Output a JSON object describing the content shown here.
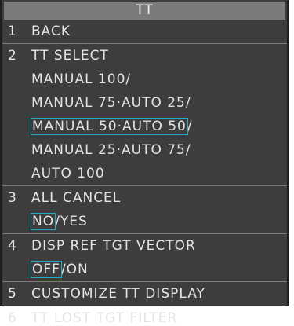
{
  "menu": {
    "title": "TT",
    "items": [
      {
        "num": "1",
        "label": "BACK"
      },
      {
        "num": "2",
        "label": "TT SELECT",
        "options": [
          "MANUAL 100/",
          "MANUAL 75·AUTO 25/",
          "MANUAL 50·AUTO 50",
          "MANUAL 25·AUTO 75/",
          "AUTO 100"
        ],
        "selected_suffix": "/"
      },
      {
        "num": "3",
        "label": "ALL CANCEL",
        "choice_selected": "NO",
        "choice_other": "/YES"
      },
      {
        "num": "4",
        "label": "DISP REF TGT VECTOR",
        "choice_selected": "OFF",
        "choice_other": "/ON"
      },
      {
        "num": "5",
        "label": "CUSTOMIZE TT DISPLAY"
      },
      {
        "num": "6",
        "label": "TT LOST TGT FILTER"
      }
    ]
  },
  "colors": {
    "panel": "#3d3d3d",
    "title_bar": "#7b7b7b",
    "text": "#e4e4e4",
    "selection": "#27a9c9"
  }
}
